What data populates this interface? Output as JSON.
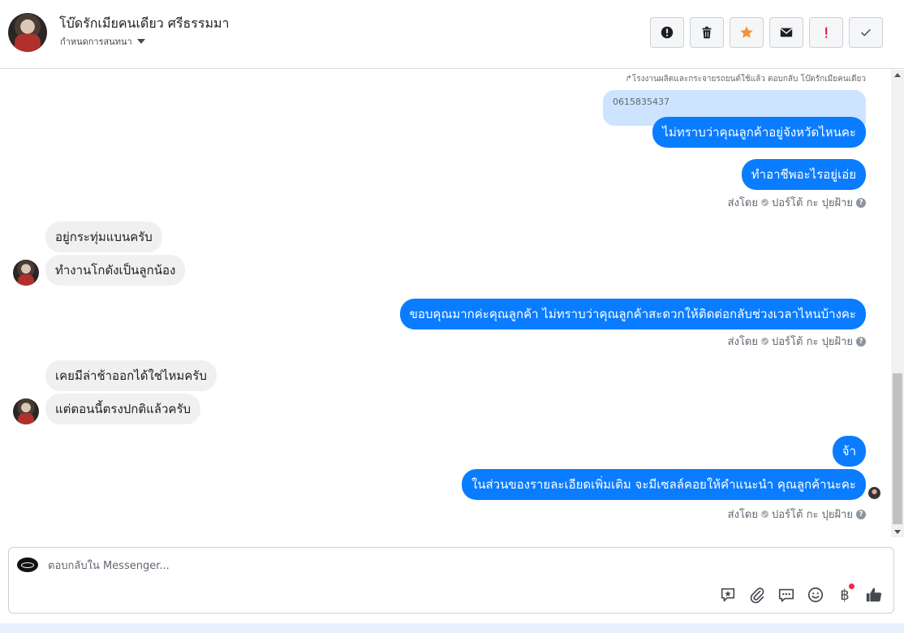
{
  "header": {
    "contact_name": "โบ๊ดรักเมียคนเดียว ศรีธรรมมา",
    "assign_label": "กำหนดการสนทนา"
  },
  "toolbar": {
    "buttons": [
      {
        "icon": "alert-circle-icon"
      },
      {
        "icon": "trash-icon"
      },
      {
        "icon": "star-icon",
        "color": "#f7923b"
      },
      {
        "icon": "envelope-icon"
      },
      {
        "icon": "exclamation-icon",
        "color": "#e41e3f"
      },
      {
        "icon": "checkmark-icon"
      }
    ]
  },
  "conversation": {
    "reply_note": "โรงงานผลิตและกระจายรถยนต์ใช้แล้ว ตอบกลับ โบ๊ดรักเมียคนเดียว",
    "quoted_text": "0615835437",
    "messages": [
      {
        "text": "ไม่ทราบว่าคุณลูกค้าอยู่จังหวัดไหนคะ"
      },
      {
        "text": "ทำอาชีพอะไรอยู่เอ่ย"
      },
      {
        "text": "อยู่กระทุ่มแบนครับ"
      },
      {
        "text": "ทำงานโกดังเป็นลูกน้อง"
      },
      {
        "text": "ขอบคุณมากค่ะคุณลูกค้า ไม่ทราบว่าคุณลูกค้าสะดวกให้ติดต่อกลับช่วงเวลาไหนบ้างคะ"
      },
      {
        "text": "เคยมีล่าช้าออกได้ใช่ไหมครับ"
      },
      {
        "text": "แต่ตอนนี้ตรงปกติแล้วครับ"
      },
      {
        "text": "จ้า"
      },
      {
        "text": "ในส่วนของรายละเอียดเพิ่มเติม จะมีเซลล์คอยให้คำแนะนำ คุณลูกค้านะคะ"
      }
    ],
    "sent_by": {
      "prefix": "ส่งโดย",
      "agent": "ปอร์โต้ กะ ปุยฝ้าย"
    }
  },
  "composer": {
    "placeholder": "ตอบกลับใน Messenger...",
    "baht_symbol": "฿"
  },
  "colors": {
    "outgoing_bubble": "#0a7cff",
    "incoming_bubble": "#f0f0f0",
    "quoted_bubble": "#cce4ff"
  }
}
